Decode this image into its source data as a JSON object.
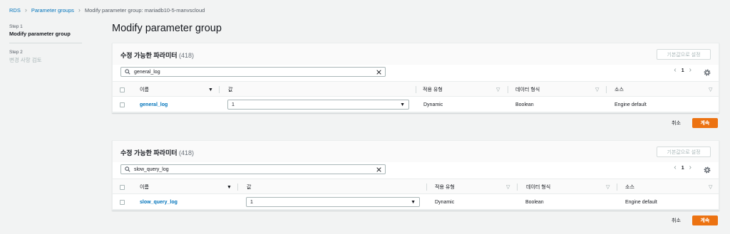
{
  "breadcrumb": {
    "items": [
      "RDS",
      "Parameter groups"
    ],
    "current": "Modify parameter group: mariadb10-5-manvscloud"
  },
  "steps": [
    {
      "num": "Step 1",
      "title": "Modify parameter group",
      "active": true
    },
    {
      "num": "Step 2",
      "title": "변경 사항 검토",
      "active": false
    }
  ],
  "page_title": "Modify parameter group",
  "panels": [
    {
      "title": "수정 가능한 파라미터",
      "count": "(418)",
      "reset_label": "기본값으로 설정",
      "search_value": "general_log",
      "page": "1",
      "columns": [
        "이름",
        "값",
        "적용 유형",
        "데이터 형식",
        "소스"
      ],
      "row": {
        "name": "general_log",
        "value": "1",
        "apply_type": "Dynamic",
        "data_type": "Boolean",
        "source": "Engine default"
      },
      "cancel_label": "취소",
      "continue_label": "계속"
    },
    {
      "title": "수정 가능한 파라미터",
      "count": "(418)",
      "reset_label": "기본값으로 설정",
      "search_value": "slow_query_log",
      "page": "1",
      "columns": [
        "이름",
        "값",
        "적용 유형",
        "데이터 형식",
        "소스"
      ],
      "row": {
        "name": "slow_query_log",
        "value": "1",
        "apply_type": "Dynamic",
        "data_type": "Boolean",
        "source": "Engine default"
      },
      "cancel_label": "취소",
      "continue_label": "계속"
    }
  ],
  "icons": {
    "breadcrumb_separator": "chevron-right-icon",
    "search": "search-icon",
    "clear": "close-icon",
    "pager_prev": "chevron-left-icon",
    "pager_next": "chevron-right-icon",
    "settings": "gear-icon",
    "sort": "sort-down-icon",
    "filter": "filter-caret-icon",
    "select": "caret-down-icon"
  },
  "colors": {
    "link": "#0073bb",
    "primary_button": "#ec7211",
    "background": "#f2f3f3"
  }
}
